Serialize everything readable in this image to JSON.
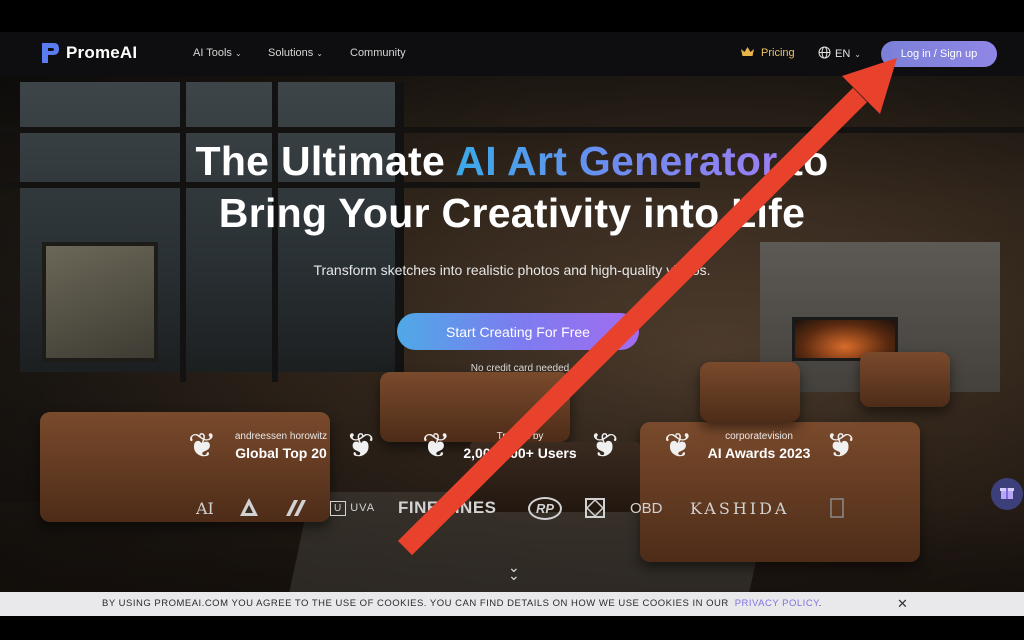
{
  "nav": {
    "logo_text": "PromeAI",
    "links": [
      {
        "label": "AI Tools",
        "has_dropdown": true
      },
      {
        "label": "Solutions",
        "has_dropdown": true
      },
      {
        "label": "Community",
        "has_dropdown": false
      }
    ],
    "pricing_label": "Pricing",
    "language_label": "EN",
    "login_label": "Log in / Sign up"
  },
  "hero": {
    "title_line1_prefix": "The Ultimate ",
    "title_line1_highlight": "AI Art Generator",
    "title_line1_suffix": " to",
    "title_line2": "Bring Your Creativity into Life",
    "subtitle": "Transform sketches into realistic photos and high-quality videos.",
    "cta_label": "Start Creating For Free",
    "no_card_note": "No credit card needed"
  },
  "awards": [
    {
      "top": "andreessen horowitz",
      "main": "Global Top 20"
    },
    {
      "top": "Trusted by",
      "main": "2,000,000+ Users"
    },
    {
      "top": "corporatevision",
      "main": "AI Awards 2023"
    }
  ],
  "partners": [
    "AI",
    "UVA",
    "FINE LINES",
    "RP",
    "OBD",
    "KASHIDA"
  ],
  "cookie": {
    "text": "BY USING PROMEAI.COM YOU AGREE TO THE USE OF COOKIES. YOU CAN FIND DETAILS ON HOW WE USE COOKIES IN OUR",
    "link": "PRIVACY POLICY",
    "end": "."
  },
  "colors": {
    "accent": "#8f86e6",
    "pricing": "#e8c36a",
    "annotation_arrow": "#e8412c"
  },
  "icons": [
    "logo-icon",
    "crown-icon",
    "globe-icon",
    "laurel-icon",
    "scroll-down-icon",
    "gift-icon",
    "close-icon"
  ]
}
